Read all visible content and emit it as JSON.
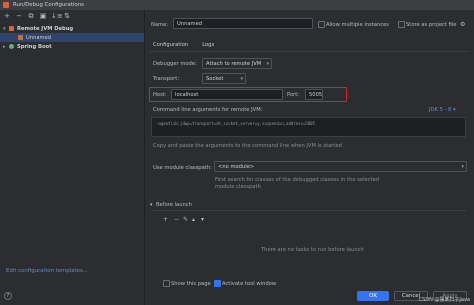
{
  "window": {
    "title": "Run/Debug Configurations"
  },
  "toolbar": [
    "+",
    "−",
    "⧉",
    "▣",
    "↓≡",
    "⇅"
  ],
  "tree": [
    {
      "label": "Remote JVM Debug",
      "expanded": true,
      "level": 0
    },
    {
      "label": "Unnamed",
      "level": 1,
      "selected": true
    },
    {
      "label": "Spring Boot",
      "expanded": false,
      "level": 0
    }
  ],
  "edit_templates": "Edit configuration templates...",
  "name": {
    "label": "Name:",
    "value": "Unnamed"
  },
  "allow_multiple": "Allow multiple instances",
  "store_as_project": "Store as project file",
  "tabs": [
    "Configuration",
    "Logs"
  ],
  "debugger_mode": {
    "label": "Debugger mode:",
    "value": "Attach to remote JVM"
  },
  "transport": {
    "label": "Transport:",
    "value": "Socket"
  },
  "host": {
    "label": "Host:",
    "value": "localhost"
  },
  "port": {
    "label": "Port:",
    "value": "5005"
  },
  "cmdline": {
    "label": "Command line arguments for remote JVM:",
    "jdk": "JDK 5 - 8 ▾",
    "value": "-agentlib:jdwp=transport=dt_socket,server=y,suspend=n,address=5005",
    "hint": "Copy and paste the arguments to the command line when JVM is started"
  },
  "module_classpath": {
    "label": "Use module classpath:",
    "value": "<no module>",
    "hint1": "First search for classes of the debugged classes in the selected",
    "hint2": "module classpath"
  },
  "before_launch": {
    "label": "Before launch",
    "empty": "There are no tasks to run before launch"
  },
  "show_page": "Show this page",
  "activate_tool": "Activate tool window",
  "buttons": {
    "ok": "OK",
    "cancel": "Cancel",
    "apply": "Apply"
  },
  "watermark": "CSDN @摆某扫子Java"
}
